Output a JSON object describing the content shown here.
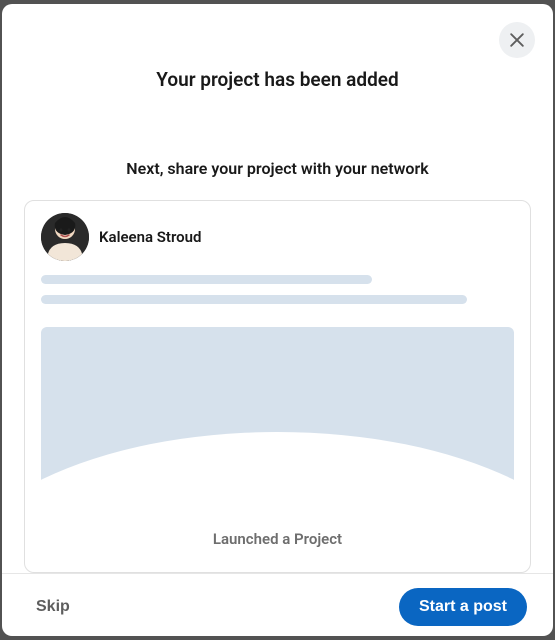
{
  "modal": {
    "title": "Your project has been added",
    "subtitle": "Next, share your project with your network"
  },
  "postCard": {
    "authorName": "Kaleena Stroud",
    "caption": "Launched a Project"
  },
  "footer": {
    "skipLabel": "Skip",
    "primaryLabel": "Start a post"
  }
}
